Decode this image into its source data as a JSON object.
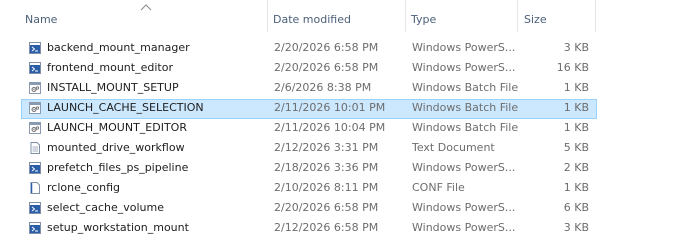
{
  "columns": {
    "name": "Name",
    "date_modified": "Date modified",
    "type": "Type",
    "size": "Size"
  },
  "sort": {
    "column": "name",
    "indicator": "chevron-up-icon"
  },
  "colors": {
    "selection_fill": "#cce8ff",
    "selection_border": "#99d1ff",
    "header_text": "#4c607a",
    "secondary_text": "#6d6d6d",
    "powershell_icon": "#2a5fa8",
    "batch_icon": "#8a9bb0"
  },
  "files": [
    {
      "name": "backend_mount_manager",
      "date": "2/20/2026 6:58 PM",
      "type": "Windows PowerS...",
      "size": "3 KB",
      "icon": "powershell-script-icon",
      "selected": false
    },
    {
      "name": "frontend_mount_editor",
      "date": "2/20/2026 6:58 PM",
      "type": "Windows PowerS...",
      "size": "16 KB",
      "icon": "powershell-script-icon",
      "selected": false
    },
    {
      "name": "INSTALL_MOUNT_SETUP",
      "date": "2/6/2026 8:38 PM",
      "type": "Windows Batch File",
      "size": "1 KB",
      "icon": "batch-file-icon",
      "selected": false
    },
    {
      "name": "LAUNCH_CACHE_SELECTION",
      "date": "2/11/2026 10:01 PM",
      "type": "Windows Batch File",
      "size": "1 KB",
      "icon": "batch-file-icon",
      "selected": true
    },
    {
      "name": "LAUNCH_MOUNT_EDITOR",
      "date": "2/11/2026 10:04 PM",
      "type": "Windows Batch File",
      "size": "1 KB",
      "icon": "batch-file-icon",
      "selected": false
    },
    {
      "name": "mounted_drive_workflow",
      "date": "2/12/2026 3:31 PM",
      "type": "Text Document",
      "size": "5 KB",
      "icon": "text-document-icon",
      "selected": false
    },
    {
      "name": "prefetch_files_ps_pipeline",
      "date": "2/18/2026 3:36 PM",
      "type": "Windows PowerS...",
      "size": "2 KB",
      "icon": "powershell-script-icon",
      "selected": false
    },
    {
      "name": "rclone_config",
      "date": "2/10/2026 8:11 PM",
      "type": "CONF File",
      "size": "1 KB",
      "icon": "config-file-icon",
      "selected": false
    },
    {
      "name": "select_cache_volume",
      "date": "2/20/2026 6:58 PM",
      "type": "Windows PowerS...",
      "size": "6 KB",
      "icon": "powershell-script-icon",
      "selected": false
    },
    {
      "name": "setup_workstation_mount",
      "date": "2/12/2026 6:58 PM",
      "type": "Windows PowerS...",
      "size": "3 KB",
      "icon": "powershell-script-icon",
      "selected": false
    }
  ]
}
